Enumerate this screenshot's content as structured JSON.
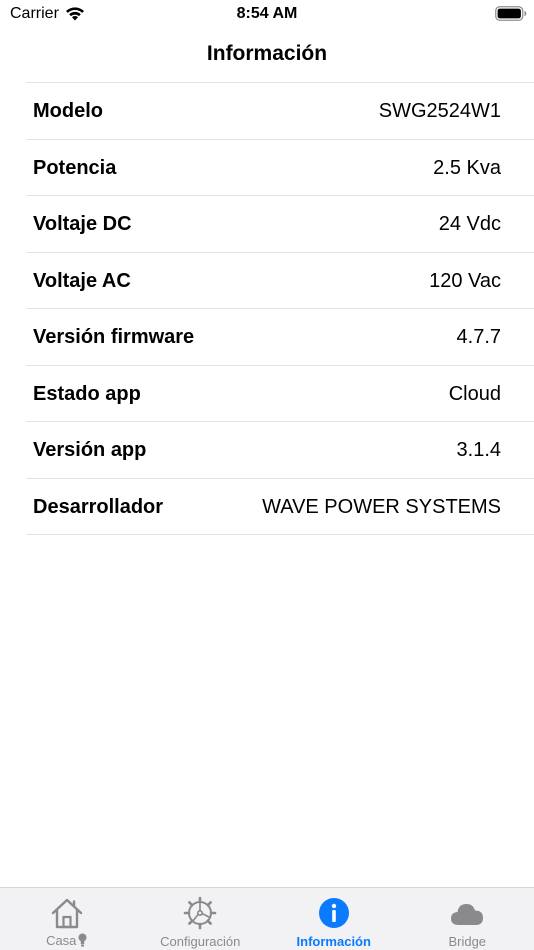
{
  "status_bar": {
    "carrier": "Carrier",
    "time": "8:54 AM"
  },
  "nav": {
    "title": "Información"
  },
  "info_rows": [
    {
      "label": "Modelo",
      "value": "SWG2524W1"
    },
    {
      "label": "Potencia",
      "value": "2.5 Kva"
    },
    {
      "label": "Voltaje DC",
      "value": "24 Vdc"
    },
    {
      "label": "Voltaje AC",
      "value": "120 Vac"
    },
    {
      "label": "Versión firmware",
      "value": "4.7.7"
    },
    {
      "label": "Estado app",
      "value": "Cloud"
    },
    {
      "label": "Versión app",
      "value": "3.1.4"
    },
    {
      "label": "Desarrollador",
      "value": "WAVE POWER SYSTEMS"
    }
  ],
  "tabs": [
    {
      "label": "Casa",
      "icon": "house-icon"
    },
    {
      "label": "Configuración",
      "icon": "gear-icon"
    },
    {
      "label": "Información",
      "icon": "info-icon",
      "active": true
    },
    {
      "label": "Bridge",
      "icon": "cloud-icon"
    }
  ],
  "colors": {
    "accent": "#0a7aff",
    "inactive": "#8a8a8e",
    "separator": "#e3e3e6",
    "tab_bar_bg": "#f2f2f4"
  }
}
